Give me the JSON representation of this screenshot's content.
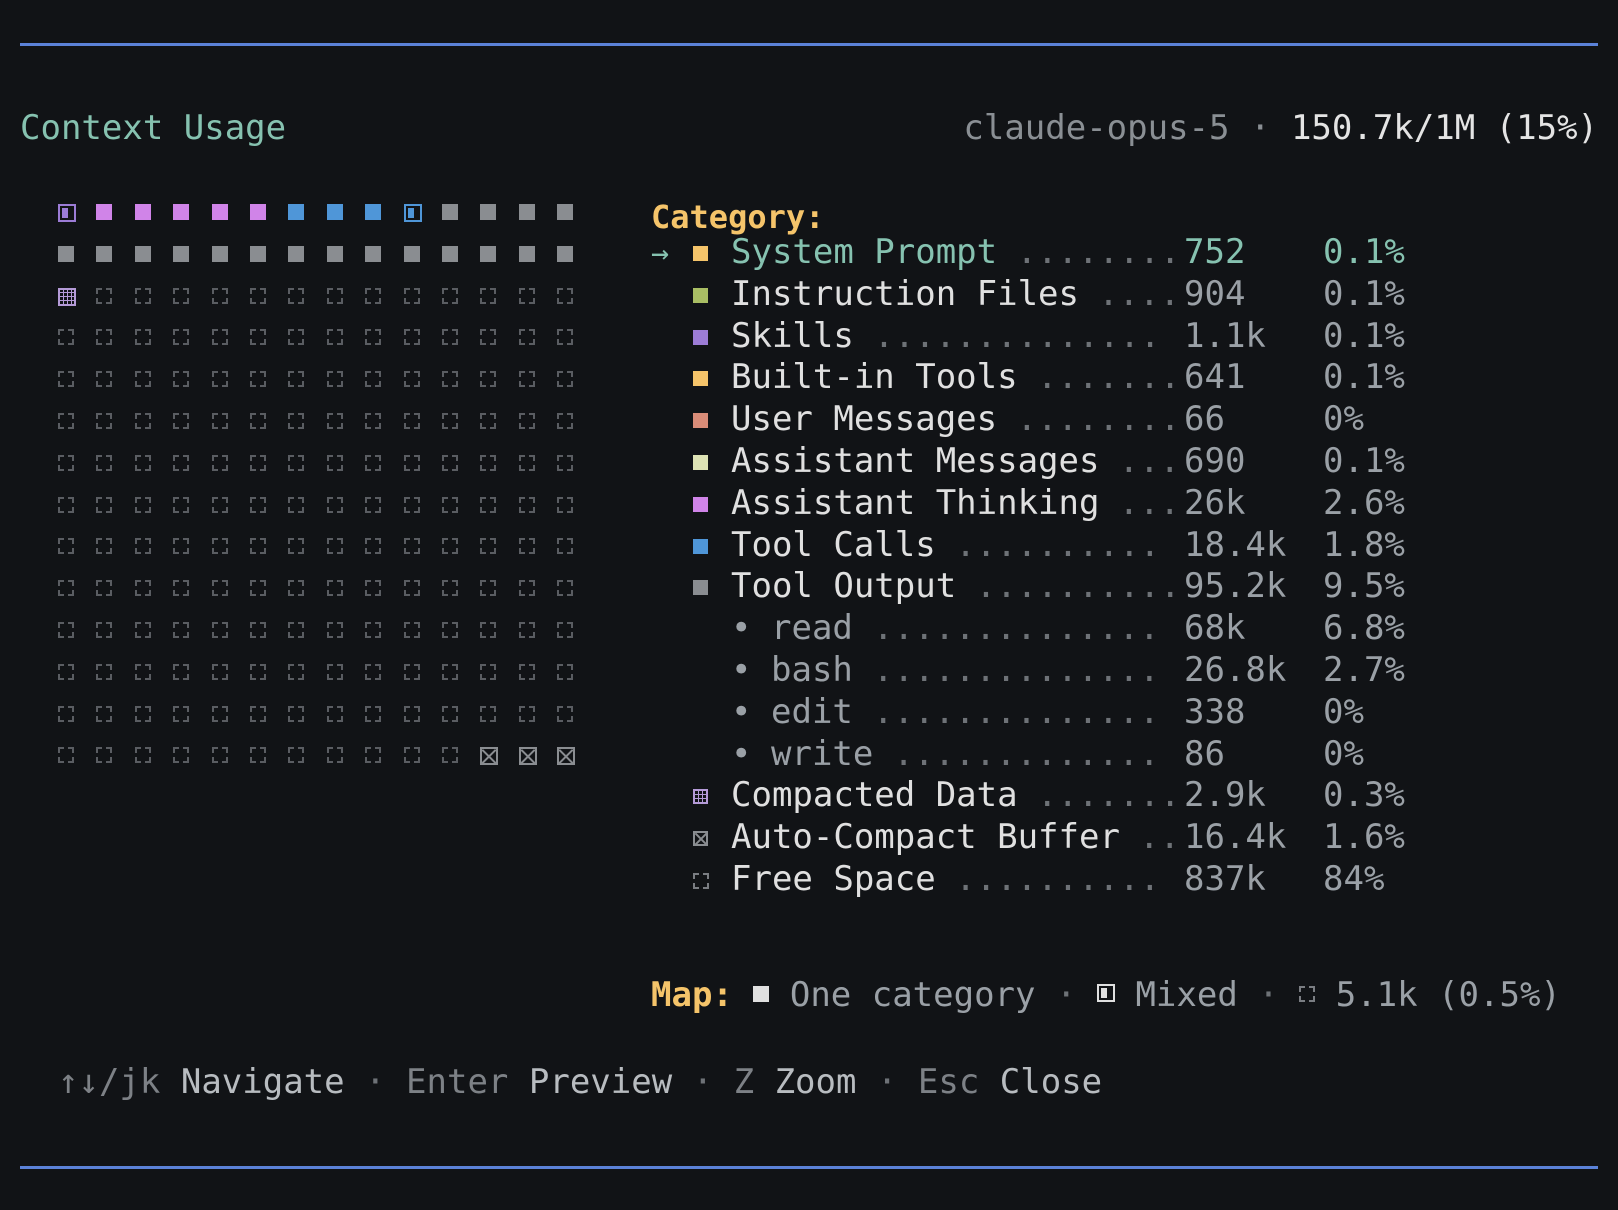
{
  "header": {
    "title": "Context Usage",
    "model": "claude-opus-5",
    "separator": "·",
    "usage": "150.7k/1M (15%)"
  },
  "colors": {
    "accent": "#86c2b0",
    "category_label": "#f5c46a",
    "rule": "#5b82d8",
    "system_prompt": "#f5c46a",
    "instruction_files": "#a9be64",
    "skills": "#9c7cd6",
    "builtin_tools": "#f5c46a",
    "user_messages": "#d98c78",
    "assistant_messages": "#dde2b4",
    "assistant_thinking": "#d084e8",
    "tool_calls": "#4f96d8",
    "tool_output": "#8a8d91"
  },
  "grid": {
    "rows": [
      [
        "mixed:skills",
        "thinking",
        "thinking",
        "thinking",
        "thinking",
        "thinking",
        "tool_calls",
        "tool_calls",
        "tool_calls",
        "mixed:tool_calls",
        "tool_output",
        "tool_output",
        "tool_output",
        "tool_output"
      ],
      [
        "tool_output",
        "tool_output",
        "tool_output",
        "tool_output",
        "tool_output",
        "tool_output",
        "tool_output",
        "tool_output",
        "tool_output",
        "tool_output",
        "tool_output",
        "tool_output",
        "tool_output",
        "tool_output"
      ],
      [
        "compact",
        "free",
        "free",
        "free",
        "free",
        "free",
        "free",
        "free",
        "free",
        "free",
        "free",
        "free",
        "free",
        "free"
      ],
      [
        "free",
        "free",
        "free",
        "free",
        "free",
        "free",
        "free",
        "free",
        "free",
        "free",
        "free",
        "free",
        "free",
        "free"
      ],
      [
        "free",
        "free",
        "free",
        "free",
        "free",
        "free",
        "free",
        "free",
        "free",
        "free",
        "free",
        "free",
        "free",
        "free"
      ],
      [
        "free",
        "free",
        "free",
        "free",
        "free",
        "free",
        "free",
        "free",
        "free",
        "free",
        "free",
        "free",
        "free",
        "free"
      ],
      [
        "free",
        "free",
        "free",
        "free",
        "free",
        "free",
        "free",
        "free",
        "free",
        "free",
        "free",
        "free",
        "free",
        "free"
      ],
      [
        "free",
        "free",
        "free",
        "free",
        "free",
        "free",
        "free",
        "free",
        "free",
        "free",
        "free",
        "free",
        "free",
        "free"
      ],
      [
        "free",
        "free",
        "free",
        "free",
        "free",
        "free",
        "free",
        "free",
        "free",
        "free",
        "free",
        "free",
        "free",
        "free"
      ],
      [
        "free",
        "free",
        "free",
        "free",
        "free",
        "free",
        "free",
        "free",
        "free",
        "free",
        "free",
        "free",
        "free",
        "free"
      ],
      [
        "free",
        "free",
        "free",
        "free",
        "free",
        "free",
        "free",
        "free",
        "free",
        "free",
        "free",
        "free",
        "free",
        "free"
      ],
      [
        "free",
        "free",
        "free",
        "free",
        "free",
        "free",
        "free",
        "free",
        "free",
        "free",
        "free",
        "free",
        "free",
        "free"
      ],
      [
        "free",
        "free",
        "free",
        "free",
        "free",
        "free",
        "free",
        "free",
        "free",
        "free",
        "free",
        "free",
        "free",
        "free"
      ],
      [
        "free",
        "free",
        "free",
        "free",
        "free",
        "free",
        "free",
        "free",
        "free",
        "free",
        "free",
        "buffer",
        "buffer",
        "buffer"
      ]
    ]
  },
  "categories": {
    "header": "Category:",
    "selected_marker": "→",
    "items": [
      {
        "key": "system_prompt",
        "name": "System Prompt",
        "dots": "........",
        "value": "752",
        "pct": "0.1%",
        "selected": true
      },
      {
        "key": "instruction_files",
        "name": "Instruction Files",
        "dots": "....",
        "value": "904",
        "pct": "0.1%"
      },
      {
        "key": "skills",
        "name": "Skills",
        "dots": "..............",
        "value": "1.1k",
        "pct": "0.1%"
      },
      {
        "key": "builtin_tools",
        "name": "Built-in Tools",
        "dots": ".......",
        "value": "641",
        "pct": "0.1%"
      },
      {
        "key": "user_messages",
        "name": "User Messages",
        "dots": "........",
        "value": "66",
        "pct": "0%"
      },
      {
        "key": "assistant_messages",
        "name": "Assistant Messages",
        "dots": "...",
        "value": "690",
        "pct": "0.1%"
      },
      {
        "key": "assistant_thinking",
        "name": "Assistant Thinking",
        "dots": "...",
        "value": "26k",
        "pct": "2.6%"
      },
      {
        "key": "tool_calls",
        "name": "Tool Calls",
        "dots": "..........",
        "value": "18.4k",
        "pct": "1.8%"
      },
      {
        "key": "tool_output",
        "name": "Tool Output",
        "dots": "..........",
        "value": "95.2k",
        "pct": "9.5%"
      },
      {
        "key": "sub",
        "bullet": "•",
        "name": "read",
        "dots": "..............",
        "value": "68k",
        "pct": "6.8%"
      },
      {
        "key": "sub",
        "bullet": "•",
        "name": "bash",
        "dots": "..............",
        "value": "26.8k",
        "pct": "2.7%"
      },
      {
        "key": "sub",
        "bullet": "•",
        "name": "edit",
        "dots": "..............",
        "value": "338",
        "pct": "0%"
      },
      {
        "key": "sub",
        "bullet": "•",
        "name": "write",
        "dots": ".............",
        "value": "86",
        "pct": "0%"
      },
      {
        "key": "compacted",
        "name": "Compacted Data",
        "dots": ".......",
        "value": "2.9k",
        "pct": "0.3%"
      },
      {
        "key": "buffer",
        "name": "Auto-Compact Buffer",
        "dots": "..",
        "value": "16.4k",
        "pct": "1.6%"
      },
      {
        "key": "free",
        "name": "Free Space",
        "dots": "..........",
        "value": "837k",
        "pct": "84%"
      }
    ]
  },
  "legend": {
    "label": "Map:",
    "one": "One category",
    "mixed": "Mixed",
    "free": "5.1k (0.5%)",
    "sep": "·"
  },
  "help": [
    {
      "key": "↑↓/jk",
      "action": "Navigate"
    },
    {
      "key": "Enter",
      "action": "Preview"
    },
    {
      "key": "Z",
      "action": "Zoom"
    },
    {
      "key": "Esc",
      "action": "Close"
    }
  ],
  "help_sep": "·"
}
